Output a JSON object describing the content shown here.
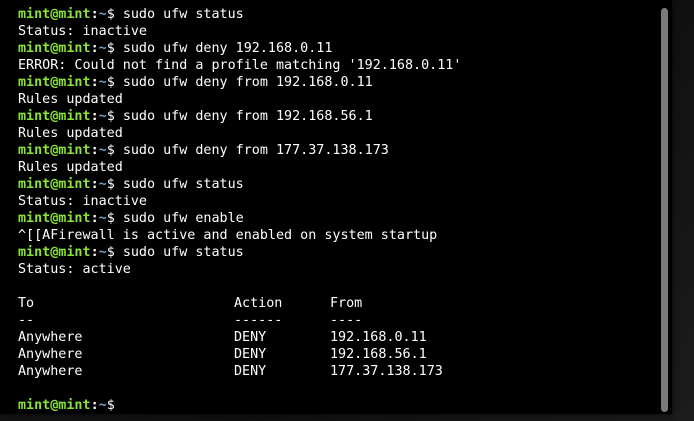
{
  "terminal": {
    "prompt": {
      "user_host": "mint@mint",
      "colon": ":",
      "path": "~",
      "dollar": "$ "
    },
    "entries": [
      {
        "command": "sudo ufw status",
        "output": [
          "Status: inactive"
        ]
      },
      {
        "command": "sudo ufw deny 192.168.0.11",
        "output": [
          "ERROR: Could not find a profile matching '192.168.0.11'"
        ]
      },
      {
        "command": "sudo ufw deny from 192.168.0.11",
        "output": [
          "Rules updated"
        ]
      },
      {
        "command": "sudo ufw deny from 192.168.56.1",
        "output": [
          "Rules updated"
        ]
      },
      {
        "command": "sudo ufw deny from 177.37.138.173",
        "output": [
          "Rules updated"
        ]
      },
      {
        "command": "sudo ufw status",
        "output": [
          "Status: inactive"
        ]
      },
      {
        "command": "sudo ufw enable",
        "output": [
          "^[[AFirewall is active and enabled on system startup"
        ]
      },
      {
        "command": "sudo ufw status",
        "output": [
          "Status: active",
          ""
        ]
      }
    ],
    "rules_table": {
      "headers": [
        "To",
        "Action",
        "From"
      ],
      "separators": [
        "--",
        "------",
        "----"
      ],
      "rows": [
        [
          "Anywhere",
          "DENY",
          "192.168.0.11"
        ],
        [
          "Anywhere",
          "DENY",
          "192.168.56.1"
        ],
        [
          "Anywhere",
          "DENY",
          "177.37.138.173"
        ]
      ]
    },
    "final_prompt_command": "",
    "colors": {
      "background": "#000000",
      "prompt_user": "#8ae234",
      "prompt_path": "#729fcf",
      "text": "#ffffff",
      "scroll_thumb": "#7a7a7a"
    }
  }
}
